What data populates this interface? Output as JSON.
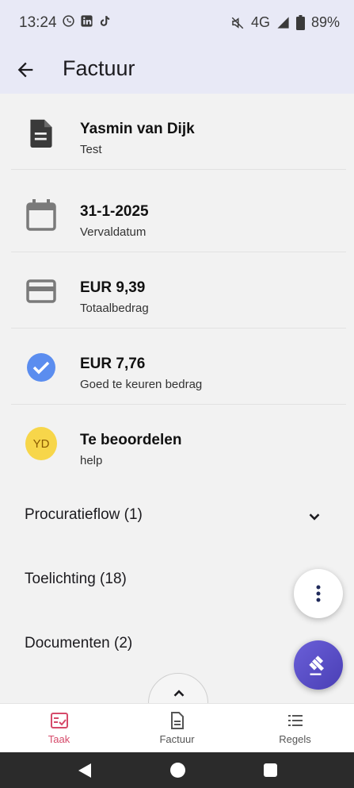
{
  "status_bar": {
    "time": "13:24",
    "network": "4G",
    "battery": "89%",
    "icons": [
      "whatsapp-icon",
      "linkedin-icon",
      "tiktok-icon",
      "mute-icon",
      "signal-icon",
      "battery-icon"
    ]
  },
  "app_bar": {
    "title": "Factuur",
    "back_icon": "arrow-back-icon"
  },
  "info_rows": [
    {
      "icon": "document-icon",
      "title": "Yasmin van Dijk",
      "subtitle": "Test"
    },
    {
      "icon": "calendar-icon",
      "title": "31-1-2025",
      "subtitle": "Vervaldatum"
    },
    {
      "icon": "credit-card-icon",
      "title": "EUR 9,39",
      "subtitle": "Totaalbedrag"
    },
    {
      "icon": "check-circle-icon",
      "title": "EUR 7,76",
      "subtitle": "Goed te keuren bedrag"
    },
    {
      "icon": "avatar",
      "avatar_initials": "YD",
      "title": "Te beoordelen",
      "subtitle": "help"
    }
  ],
  "sections": [
    {
      "label": "Procuratieflow (1)"
    },
    {
      "label": "Toelichting (18)"
    },
    {
      "label": "Documenten (2)"
    }
  ],
  "bottom_nav": [
    {
      "label": "Taak",
      "icon": "task-check-icon",
      "active": true
    },
    {
      "label": "Factuur",
      "icon": "document-outline-icon",
      "active": false
    },
    {
      "label": "Regels",
      "icon": "list-icon",
      "active": false
    }
  ],
  "colors": {
    "app_bar_bg": "#e8e9f6",
    "accent_active": "#d64a6a",
    "check_blue": "#5b8def",
    "avatar_yellow": "#f7d64a",
    "fab_purple": "#5a4fc8"
  }
}
